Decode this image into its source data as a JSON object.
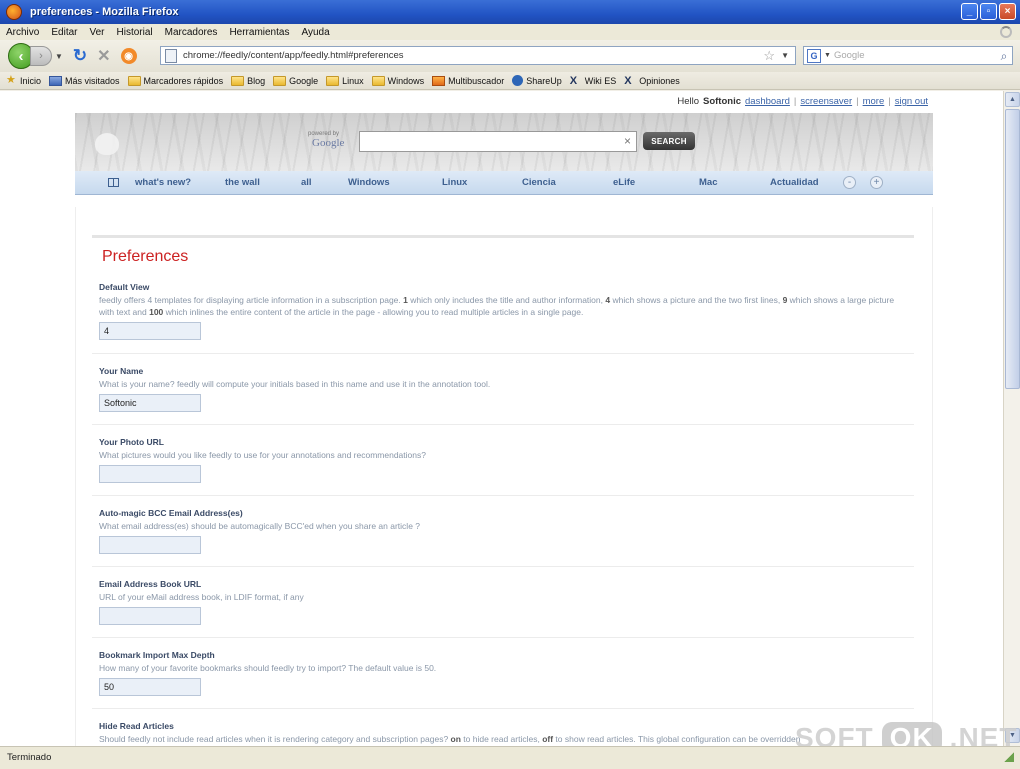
{
  "window": {
    "title": "preferences - Mozilla Firefox",
    "icon_text": "Γ |"
  },
  "menu": [
    "Archivo",
    "Editar",
    "Ver",
    "Historial",
    "Marcadores",
    "Herramientas",
    "Ayuda"
  ],
  "nav": {
    "url": "chrome://feedly/content/app/feedly.html#preferences",
    "search_placeholder": "Google",
    "search_engine_letter": "G"
  },
  "bookmarks": [
    {
      "label": "Inicio",
      "icon": "star-icon"
    },
    {
      "label": "Más visitados",
      "icon": "page-icon"
    },
    {
      "label": "Marcadores rápidos",
      "icon": "folder-icon"
    },
    {
      "label": "Blog",
      "icon": "folder-icon"
    },
    {
      "label": "Google",
      "icon": "folder-icon"
    },
    {
      "label": "Linux",
      "icon": "folder-icon"
    },
    {
      "label": "Windows",
      "icon": "folder-icon"
    },
    {
      "label": "Multibuscador",
      "icon": "multibuscador-icon"
    },
    {
      "label": "ShareUp",
      "icon": "shareup-icon"
    },
    {
      "label": "Wiki ES",
      "icon": "wiki-icon"
    },
    {
      "label": "Opiniones",
      "icon": "wiki-icon"
    }
  ],
  "userbar": {
    "hello": "Hello",
    "user": "Softonic",
    "links": [
      "dashboard",
      "screensaver",
      "more",
      "sign out"
    ]
  },
  "header": {
    "powered_by": "powered by",
    "google": "Google",
    "search_button": "SEARCH",
    "clear": "×"
  },
  "tabs": [
    "what's new?",
    "the wall",
    "all",
    "Windows",
    "Linux",
    "Ciencia",
    "eLife",
    "Mac",
    "Actualidad"
  ],
  "tab_buttons": [
    "-",
    "+"
  ],
  "page": {
    "title": "Preferences"
  },
  "fields": [
    {
      "label": "Default View",
      "desc_parts": [
        "feedly offers 4 templates for displaying article information in a subscription page. ",
        "1",
        " which only includes the title and author information, ",
        "4",
        " which shows a picture and the two first lines, ",
        "9",
        " which shows a large picture with text and ",
        "100",
        " which inlines the entire content of the article in the page - allowing you to read multiple articles in a single page."
      ],
      "value": "4"
    },
    {
      "label": "Your Name",
      "desc": "What is your name? feedly will compute your initials based in this name and use it in the annotation tool.",
      "value": "Softonic"
    },
    {
      "label": "Your Photo URL",
      "desc": "What pictures would you like feedly to use for your annotations and recommendations?",
      "value": ""
    },
    {
      "label": "Auto-magic BCC Email Address(es)",
      "desc": "What email address(es) should be automagically BCC'ed when you share an article ?",
      "value": ""
    },
    {
      "label": "Email Address Book URL",
      "desc": "URL of your eMail address book, in LDIF format, if any",
      "value": ""
    },
    {
      "label": "Bookmark Import Max Depth",
      "desc": "How many of your favorite bookmarks should feedly try to import? The default value is 50.",
      "value": "50"
    },
    {
      "label": "Hide Read Articles",
      "desc_parts": [
        "Should feedly not include read articles when it is rendering category and subscription pages? ",
        "on",
        " to hide read articles, ",
        "off",
        " to show read articles. This global configuration can be overridden"
      ]
    }
  ],
  "status": {
    "text": "Terminado"
  },
  "watermark": {
    "left": "SOFT",
    "box": "OK",
    "right": ".NET"
  }
}
